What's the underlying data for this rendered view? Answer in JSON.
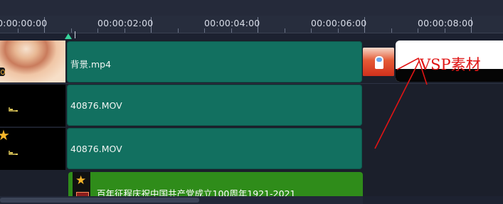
{
  "ruler": {
    "labels": [
      "00:00:00:00",
      "00:00:02:00",
      "00:00:04:00",
      "00:00:06:00",
      "00:00:08:00"
    ]
  },
  "tracks": [
    {
      "clip_label": "背景.mp4"
    },
    {
      "clip_label": "40876.MOV"
    },
    {
      "clip_label": "40876.MOV"
    },
    {
      "clip_label": "百年征程庆祝中国共产党成立100周年1921-2021"
    }
  ],
  "annotation": {
    "text": "VSP素材",
    "color": "#e01414"
  },
  "colors": {
    "video_clip": "#127060",
    "title_clip": "#2f8c1a",
    "playhead": "#37d39b",
    "star": "#f6b52a"
  }
}
